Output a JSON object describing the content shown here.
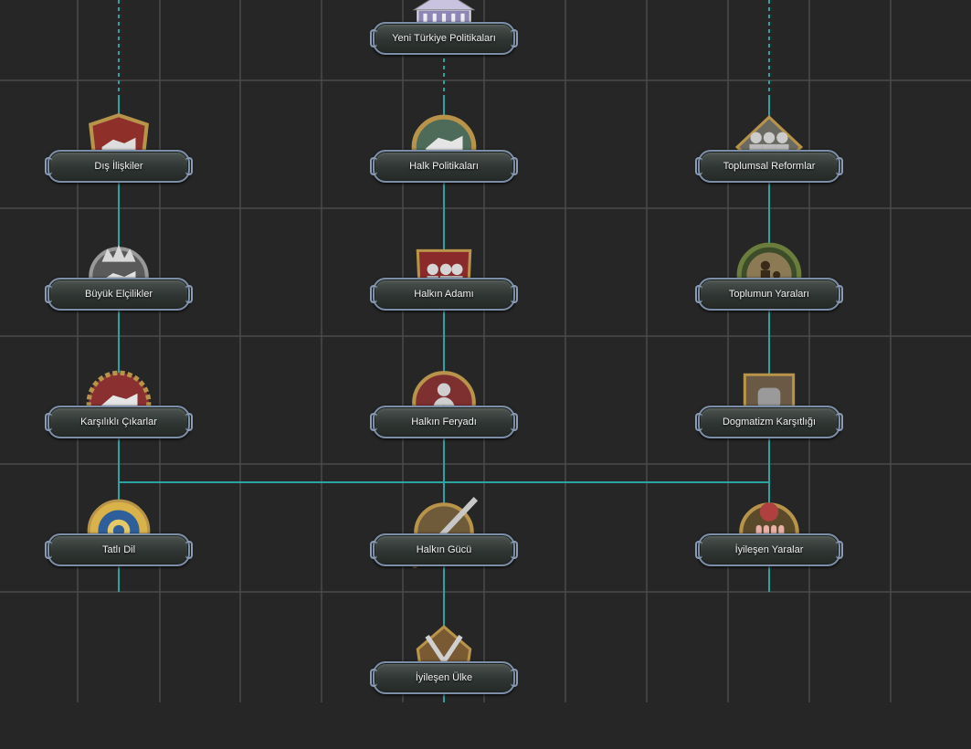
{
  "focus_tree": {
    "nodes": [
      {
        "id": "yeni-turkiye",
        "label": "Yeni Türkiye Politikaları",
        "col": 1,
        "row": -1,
        "icon": "parliament-building-icon",
        "accent": "#8f86b8"
      },
      {
        "id": "dis-iliskiler",
        "label": "Dış İlişkiler",
        "col": 0,
        "row": 0,
        "icon": "handshake-shield-icon",
        "accent": "#8e2f2a"
      },
      {
        "id": "halk-politikalari",
        "label": "Halk Politikaları",
        "col": 1,
        "row": 0,
        "icon": "handshake-medal-icon",
        "accent": "#4e6b5a"
      },
      {
        "id": "toplumsal-reformlar",
        "label": "Toplumsal Reformlar",
        "col": 2,
        "row": 0,
        "icon": "soldiers-crowd-icon",
        "accent": "#6b6a62"
      },
      {
        "id": "buyuk-elcilikler",
        "label": "Büyük Elçilikler",
        "col": 0,
        "row": 1,
        "icon": "crown-handshake-icon",
        "accent": "#5a5a5a"
      },
      {
        "id": "halkin-adami",
        "label": "Halkın Adamı",
        "col": 1,
        "row": 1,
        "icon": "people-gathering-icon",
        "accent": "#8a2a2a"
      },
      {
        "id": "toplumun-yaralari",
        "label": "Toplumun Yaraları",
        "col": 2,
        "row": 1,
        "icon": "family-wreath-icon",
        "accent": "#8c7a55"
      },
      {
        "id": "karsilikli-cikarlar",
        "label": "Karşılıklı Çıkarlar",
        "col": 0,
        "row": 2,
        "icon": "handshake-laurel-icon",
        "accent": "#8a3030"
      },
      {
        "id": "halkin-feryadi",
        "label": "Halkın Feryadı",
        "col": 1,
        "row": 2,
        "icon": "money-bag-icon",
        "accent": "#7e2f2f"
      },
      {
        "id": "dogmatizm-karsitligi",
        "label": "Dogmatizm Karşıtlığı",
        "col": 2,
        "row": 2,
        "icon": "raised-fist-icon",
        "accent": "#9a9a9a"
      },
      {
        "id": "tatli-dil",
        "label": "Tatlı Dil",
        "col": 0,
        "row": 3,
        "icon": "diplomacy-emblem-icon",
        "accent": "#2f5f9a"
      },
      {
        "id": "halkin-gucu",
        "label": "Halkın Gücü",
        "col": 1,
        "row": 3,
        "icon": "rifle-medal-icon",
        "accent": "#6f5a3a"
      },
      {
        "id": "iyilesen-yaralar",
        "label": "İyileşen Yaralar",
        "col": 2,
        "row": 3,
        "icon": "hands-flower-icon",
        "accent": "#b04040"
      },
      {
        "id": "iyilesen-ulke",
        "label": "İyileşen Ülke",
        "col": 1,
        "row": 4,
        "icon": "crossed-swords-icon",
        "accent": "#7a5a32"
      }
    ],
    "colors": {
      "background": "#262626",
      "grid": "#4a4a4a",
      "connector": "#2aa3a3",
      "gold": "#b8934a"
    }
  }
}
